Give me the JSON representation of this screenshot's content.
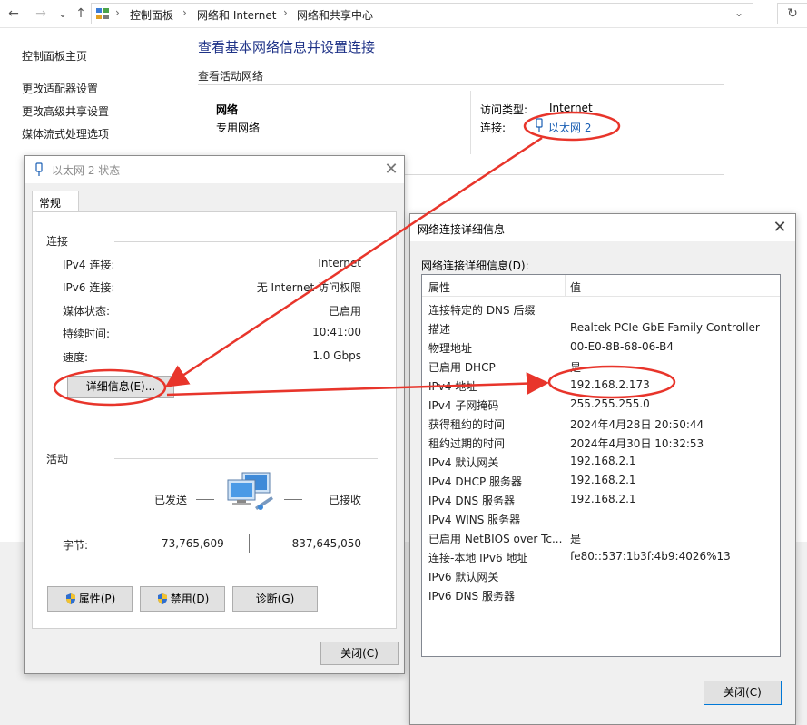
{
  "explorer": {
    "nav_back": "←",
    "nav_forward": "→",
    "nav_recent": "⌄",
    "nav_up": "↑",
    "breadcrumbs": [
      "控制面板",
      "网络和 Internet",
      "网络和共享中心"
    ],
    "separator": "›",
    "dropdown": "⌄",
    "refresh": "↻"
  },
  "sidebar": {
    "items": [
      {
        "label": "控制面板主页"
      },
      {
        "label": "更改适配器设置"
      },
      {
        "label": "更改高级共享设置"
      },
      {
        "label": "媒体流式处理选项"
      }
    ]
  },
  "main": {
    "title": "查看基本网络信息并设置连接",
    "subtitle": "查看活动网络",
    "network_name": "网络",
    "network_type": "专用网络",
    "access_type_label": "访问类型:",
    "access_type_value": "Internet",
    "connection_label": "连接:",
    "connection_value": "以太网 2"
  },
  "status_dialog": {
    "title": "以太网 2 状态",
    "tab": "常规",
    "connection_header": "连接",
    "rows": [
      {
        "label": "IPv4 连接:",
        "value": "Internet"
      },
      {
        "label": "IPv6 连接:",
        "value": "无 Internet 访问权限"
      },
      {
        "label": "媒体状态:",
        "value": "已启用"
      },
      {
        "label": "持续时间:",
        "value": "10:41:00"
      },
      {
        "label": "速度:",
        "value": "1.0 Gbps"
      }
    ],
    "details_button": "详细信息(E)...",
    "activity_header": "活动",
    "sent_label": "已发送",
    "received_label": "已接收",
    "bytes_label": "字节:",
    "bytes_sent": "73,765,609",
    "bytes_received": "837,645,050",
    "properties_button": "属性(P)",
    "disable_button": "禁用(D)",
    "diagnose_button": "诊断(G)",
    "close_button": "关闭(C)"
  },
  "details_dialog": {
    "title": "网络连接详细信息",
    "list_label": "网络连接详细信息(D):",
    "col_property": "属性",
    "col_value": "值",
    "rows": [
      {
        "prop": "连接特定的 DNS 后缀",
        "value": ""
      },
      {
        "prop": "描述",
        "value": "Realtek PCIe GbE Family Controller"
      },
      {
        "prop": "物理地址",
        "value": "00-E0-8B-68-06-B4"
      },
      {
        "prop": "已启用 DHCP",
        "value": "是"
      },
      {
        "prop": "IPv4 地址",
        "value": "192.168.2.173"
      },
      {
        "prop": "IPv4 子网掩码",
        "value": "255.255.255.0"
      },
      {
        "prop": "获得租约的时间",
        "value": "2024年4月28日 20:50:44"
      },
      {
        "prop": "租约过期的时间",
        "value": "2024年4月30日 10:32:53"
      },
      {
        "prop": "IPv4 默认网关",
        "value": "192.168.2.1"
      },
      {
        "prop": "IPv4 DHCP 服务器",
        "value": "192.168.2.1"
      },
      {
        "prop": "IPv4 DNS 服务器",
        "value": "192.168.2.1"
      },
      {
        "prop": "IPv4 WINS 服务器",
        "value": ""
      },
      {
        "prop": "已启用 NetBIOS over Tc...",
        "value": "是"
      },
      {
        "prop": "连接-本地 IPv6 地址",
        "value": "fe80::537:1b3f:4b9:4026%13"
      },
      {
        "prop": "IPv6 默认网关",
        "value": ""
      },
      {
        "prop": "IPv6 DNS 服务器",
        "value": ""
      }
    ],
    "close_button": "关闭(C)",
    "close_x": "✕"
  },
  "colors": {
    "annotation": "#e8352b",
    "link": "#1a5fb4",
    "title_blue": "#1e3287"
  }
}
